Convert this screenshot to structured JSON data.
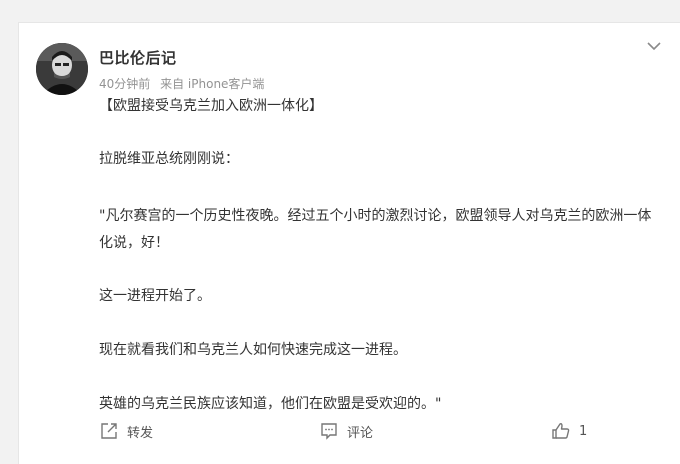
{
  "post": {
    "author": "巴比伦后记",
    "time": "40分钟前",
    "source": "来自 iPhone客户端",
    "title": "【欧盟接受乌克兰加入欧洲一体化】",
    "paragraphs": [
      "拉脱维亚总统刚刚说：",
      "\"凡尔赛宫的一个历史性夜晚。经过五个小时的激烈讨论，欧盟领导人对乌克兰的欧洲一体化说，好！",
      "这一进程开始了。",
      "现在就看我们和乌克兰人如何快速完成这一进程。",
      "英雄的乌克兰民族应该知道，他们在欧盟是受欢迎的。\""
    ]
  },
  "actions": {
    "repost_label": "转发",
    "comment_label": "评论",
    "like_count": "1"
  },
  "icons": {
    "menu": "chevron-down-icon",
    "repost": "share-icon",
    "comment": "comment-icon",
    "like": "thumbs-up-icon"
  }
}
